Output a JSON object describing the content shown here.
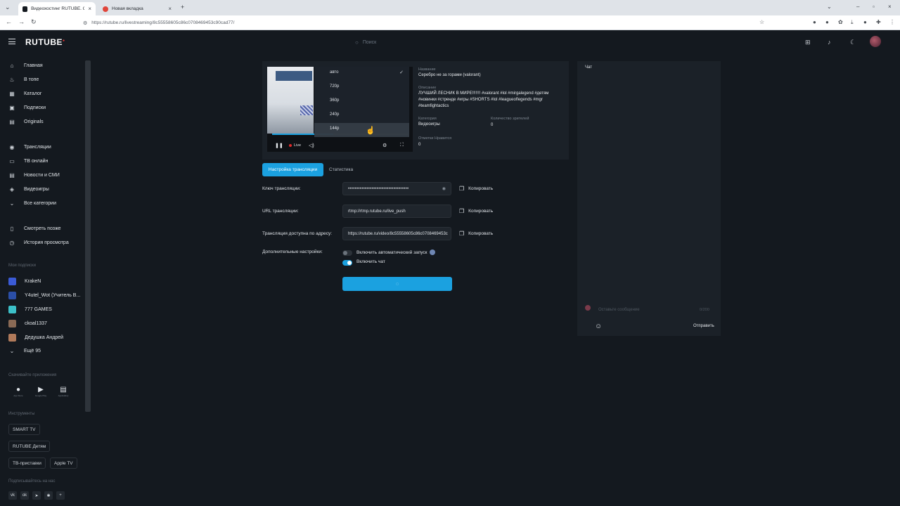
{
  "browser": {
    "tabs": [
      {
        "title": "Видеохостинг RUTUBE. Смотр... воспроизводится",
        "favicon_color": "#14191f"
      },
      {
        "title": "Новая вкладка",
        "favicon_color": "#e0453a"
      }
    ],
    "url": "https://rutube.ru/livestreaming/8c55558605c86c0708469453c90cad77/"
  },
  "header": {
    "logo": "RUTUBE",
    "search_placeholder": "Поиск"
  },
  "sidebar": {
    "main": [
      {
        "label": "Главная",
        "icon": "home-icon"
      },
      {
        "label": "В топе",
        "icon": "fire-icon"
      },
      {
        "label": "Каталог",
        "icon": "grid-icon"
      },
      {
        "label": "Подписки",
        "icon": "subscriptions-icon"
      },
      {
        "label": "Originals",
        "icon": "originals-icon"
      }
    ],
    "secondary": [
      {
        "label": "Трансляции",
        "icon": "broadcast-icon"
      },
      {
        "label": "ТВ онлайн",
        "icon": "tv-icon"
      },
      {
        "label": "Новости и СМИ",
        "icon": "news-icon"
      },
      {
        "label": "Видеоигры",
        "icon": "gamepad-icon"
      },
      {
        "label": "Все категории",
        "icon": "chevron-down-icon"
      }
    ],
    "library": [
      {
        "label": "Смотреть позже",
        "icon": "bookmark-icon"
      },
      {
        "label": "История просмотра",
        "icon": "history-icon"
      }
    ],
    "subscriptions_heading": "Мои подписки",
    "subscriptions": [
      {
        "label": "KrakeN",
        "color": "#3b5bd6"
      },
      {
        "label": "Y4utel_Wot (Учитель В...",
        "color": "#2b4fa8"
      },
      {
        "label": "777 GAMES",
        "color": "#3cc0c8"
      },
      {
        "label": "ckoal1337",
        "color": "#8a6a55"
      },
      {
        "label": "Дедушка Андрей",
        "color": "#b07a5a"
      }
    ],
    "more_label": "Ещё 95",
    "apps_heading": "Скачивайте приложения",
    "apps": [
      {
        "icon": "apple-icon",
        "caption": "App Store"
      },
      {
        "icon": "google-play-icon",
        "caption": "Google Play"
      },
      {
        "icon": "app-gallery-icon",
        "caption": "AppGallery"
      }
    ],
    "tools_heading": "Инструменты",
    "tools": [
      "SMART TV",
      "RUTUBE Детям",
      "ТВ-приставки",
      "Apple TV"
    ],
    "social_heading": "Подписывайтесь на нас"
  },
  "player": {
    "qualities": [
      "авто",
      "720p",
      "360p",
      "240p",
      "144p"
    ],
    "selected_quality": "авто",
    "live_label": "Live",
    "progress": 0.45
  },
  "stream_info": {
    "title_label": "Название",
    "title_value": "Серебро не за горами (valorant)",
    "description_label": "Описание",
    "description_value": "ЛУЧШИЙ ЛЕСНИК В МИРЕ!!!!!!! #valorant #lol #mirgalegend #детям #новинки #стрендe #игры #SHORTS #lol #leagueoflegends #mgr #teamfightactics",
    "category_label": "Категория",
    "category_value": "Видеоигры",
    "viewers_label": "Количество зрителей",
    "viewers_value": "0",
    "likes_label": "Отметки Нравится",
    "likes_value": "0"
  },
  "tabs": {
    "settings": "Настройка трансляции",
    "stats": "Статистика"
  },
  "form": {
    "key_label": "Ключ трансляции:",
    "key_value": "••••••••••••••••••••••••••••••••••••",
    "url_label": "URL трансляции:",
    "url_value": "rtmp://rtmp.rutube.ru/live_push",
    "address_label": "Трансляция доступна по адресу:",
    "address_value": "https://rutube.ru/video/8c55558605c86c0708469453c",
    "copy_label": "Копировать",
    "extra_label": "Дополнительные настройки:",
    "autostart_label": "Включить автоматический запуск",
    "autostart_on": false,
    "chat_label": "Включить чат",
    "chat_on": true
  },
  "chat": {
    "title": "Чат",
    "input_placeholder": "Оставьте сообщение",
    "counter": "0/200",
    "send_label": "Отправить"
  }
}
